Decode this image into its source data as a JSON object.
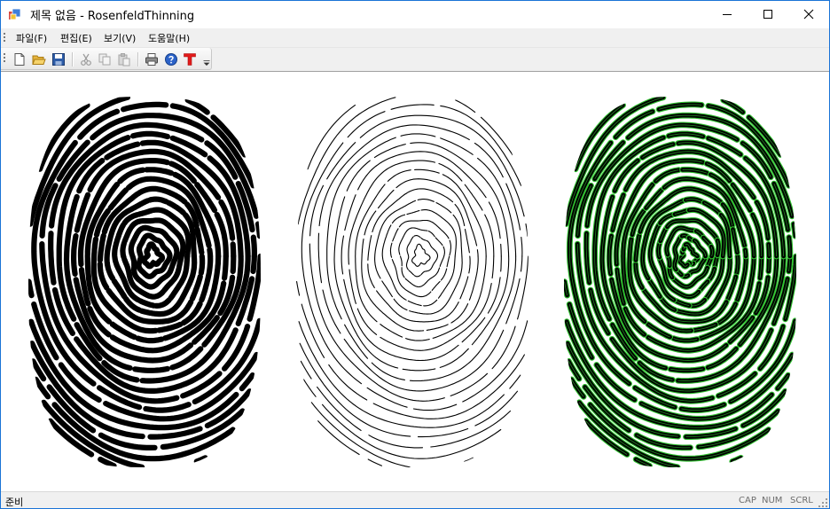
{
  "window": {
    "title": "제목 없음 - RosenfeldThinning"
  },
  "menu": {
    "file": "파일(F)",
    "edit": "편집(E)",
    "view": "보기(V)",
    "help": "도움말(H)"
  },
  "toolbar": {
    "icons": [
      "new-file-icon",
      "open-folder-icon",
      "save-disk-icon",
      "cut-icon",
      "copy-icon",
      "paste-icon",
      "print-icon",
      "about-help-icon",
      "thinning-t-icon"
    ]
  },
  "images": {
    "panels": [
      "binary-fingerprint",
      "thinned-skeleton",
      "skeleton-overlay"
    ],
    "colors": {
      "ridge": "#000000",
      "overlay_edge": "#2fbf2f"
    }
  },
  "status": {
    "text": "준비",
    "cap": "CAP",
    "num": "NUM",
    "scrl": "SCRL"
  }
}
